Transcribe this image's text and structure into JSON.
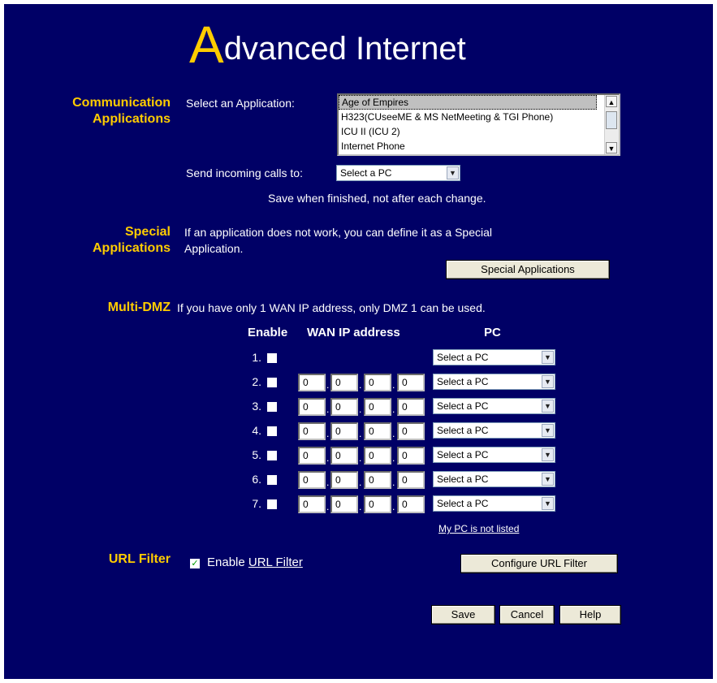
{
  "title": {
    "initial": "A",
    "rest": "dvanced Internet"
  },
  "communication": {
    "heading_line1": "Communication",
    "heading_line2": "Applications",
    "select_label": "Select an Application:",
    "applications": [
      "Age of Empires",
      "H323(CUseeME & MS NetMeeting & TGI Phone)",
      "ICU II (ICU 2)",
      "Internet Phone"
    ],
    "selected_index": 0,
    "send_label": "Send incoming calls to:",
    "send_value": "Select a PC",
    "save_note": "Save when finished, not after each change."
  },
  "special": {
    "heading_line1": "Special",
    "heading_line2": "Applications",
    "text_line1": "If an application does not work, you can define it as a Special",
    "text_line2": "Application.",
    "button_label": "Special Applications"
  },
  "dmz": {
    "heading": "Multi-DMZ",
    "text": "If you have only 1 WAN IP address, only DMZ 1 can be used.",
    "col_enable": "Enable",
    "col_wan": "WAN IP address",
    "col_pc": "PC",
    "rows": [
      {
        "num": "1.",
        "ip": null,
        "pc": "Select a PC"
      },
      {
        "num": "2.",
        "ip": [
          "0",
          "0",
          "0",
          "0"
        ],
        "pc": "Select a PC"
      },
      {
        "num": "3.",
        "ip": [
          "0",
          "0",
          "0",
          "0"
        ],
        "pc": "Select a PC"
      },
      {
        "num": "4.",
        "ip": [
          "0",
          "0",
          "0",
          "0"
        ],
        "pc": "Select a PC"
      },
      {
        "num": "5.",
        "ip": [
          "0",
          "0",
          "0",
          "0"
        ],
        "pc": "Select a PC"
      },
      {
        "num": "6.",
        "ip": [
          "0",
          "0",
          "0",
          "0"
        ],
        "pc": "Select a PC"
      },
      {
        "num": "7.",
        "ip": [
          "0",
          "0",
          "0",
          "0"
        ],
        "pc": "Select a PC"
      }
    ],
    "not_listed_link": "My PC is not listed"
  },
  "url_filter": {
    "heading": "URL Filter",
    "enable_prefix": "Enable ",
    "enable_link": "URL Filter",
    "enabled": true,
    "configure_button": "Configure URL Filter"
  },
  "actions": {
    "save": "Save",
    "cancel": "Cancel",
    "help": "Help"
  },
  "colors": {
    "background": "#000066",
    "accent": "#ffcc00",
    "text": "#ffffff"
  }
}
